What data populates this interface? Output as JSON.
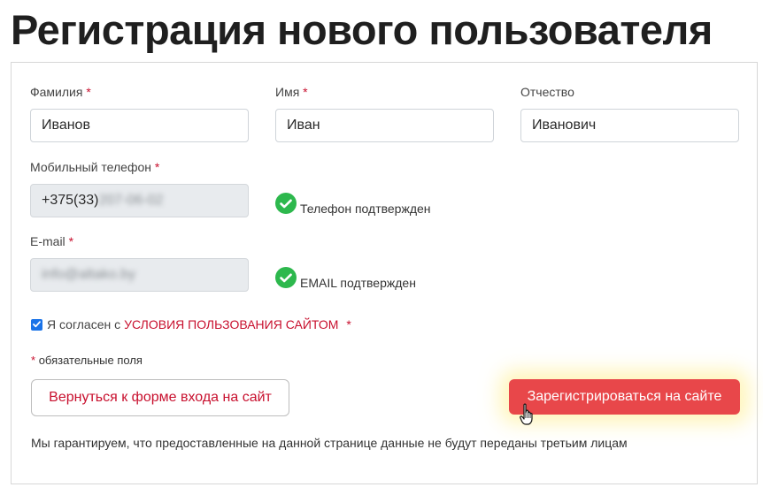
{
  "page": {
    "title": "Регистрация нового пользователя"
  },
  "form": {
    "last_name": {
      "label": "Фамилия",
      "required_mark": "*",
      "value": "Иванов"
    },
    "first_name": {
      "label": "Имя",
      "required_mark": "*",
      "value": "Иван"
    },
    "middle_name": {
      "label": "Отчество",
      "value": "Иванович"
    },
    "phone": {
      "label": "Мобильный телефон",
      "required_mark": "*",
      "value_prefix": "+375(33)",
      "value_hidden": "207-06-02",
      "status": "Телефон подтвержден"
    },
    "email": {
      "label": "E-mail",
      "required_mark": "*",
      "value_hidden": "info@altako.by",
      "status": "EMAIL подтвержден"
    },
    "agree": {
      "checked": true,
      "text": "Я согласен с",
      "link": "УСЛОВИЯ ПОЛЬЗОВАНИЯ САЙТОМ",
      "required_mark": "*"
    },
    "required_note": {
      "mark": "*",
      "text": "обязательные поля"
    },
    "back_button": "Вернуться к форме входа на сайт",
    "register_button": "Зарегистрироваться на сайте",
    "guarantee": "Мы гарантируем, что предоставленные на данной странице данные не будут переданы третьим лицам"
  },
  "colors": {
    "accent_red": "#c8102e",
    "button_red": "#e8474a",
    "success_green": "#2db84d"
  },
  "icons": {
    "verified": "check-circle-icon",
    "cursor": "hand-pointer-icon"
  }
}
